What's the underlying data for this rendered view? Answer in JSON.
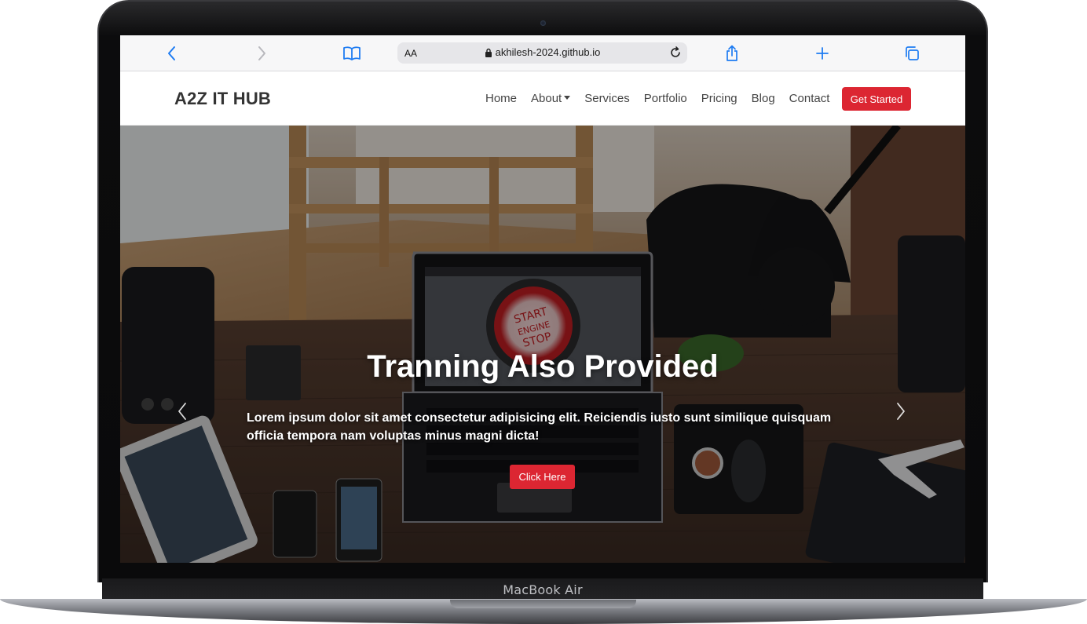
{
  "device": {
    "label": "MacBook Air"
  },
  "browser": {
    "text_size_label": "AA",
    "url": "akhilesh-2024.github.io",
    "accent": "#1e7cf2"
  },
  "site": {
    "brand": "A2Z IT HUB",
    "nav": [
      {
        "label": "Home"
      },
      {
        "label": "About",
        "dropdown": true
      },
      {
        "label": "Services"
      },
      {
        "label": "Portfolio"
      },
      {
        "label": "Pricing"
      },
      {
        "label": "Blog"
      },
      {
        "label": "Contact"
      }
    ],
    "cta_label": "Get Started",
    "accent": "#dc2632"
  },
  "hero": {
    "title": "Tranning Also Provided",
    "text": "Lorem ipsum dolor sit amet consectetur adipisicing elit. Reiciendis iusto sunt similique quisquam officia tempora nam voluptas minus magni dicta!",
    "button_label": "Click Here",
    "laptop_screen_text": [
      "START",
      "ENGINE",
      "STOP"
    ]
  }
}
